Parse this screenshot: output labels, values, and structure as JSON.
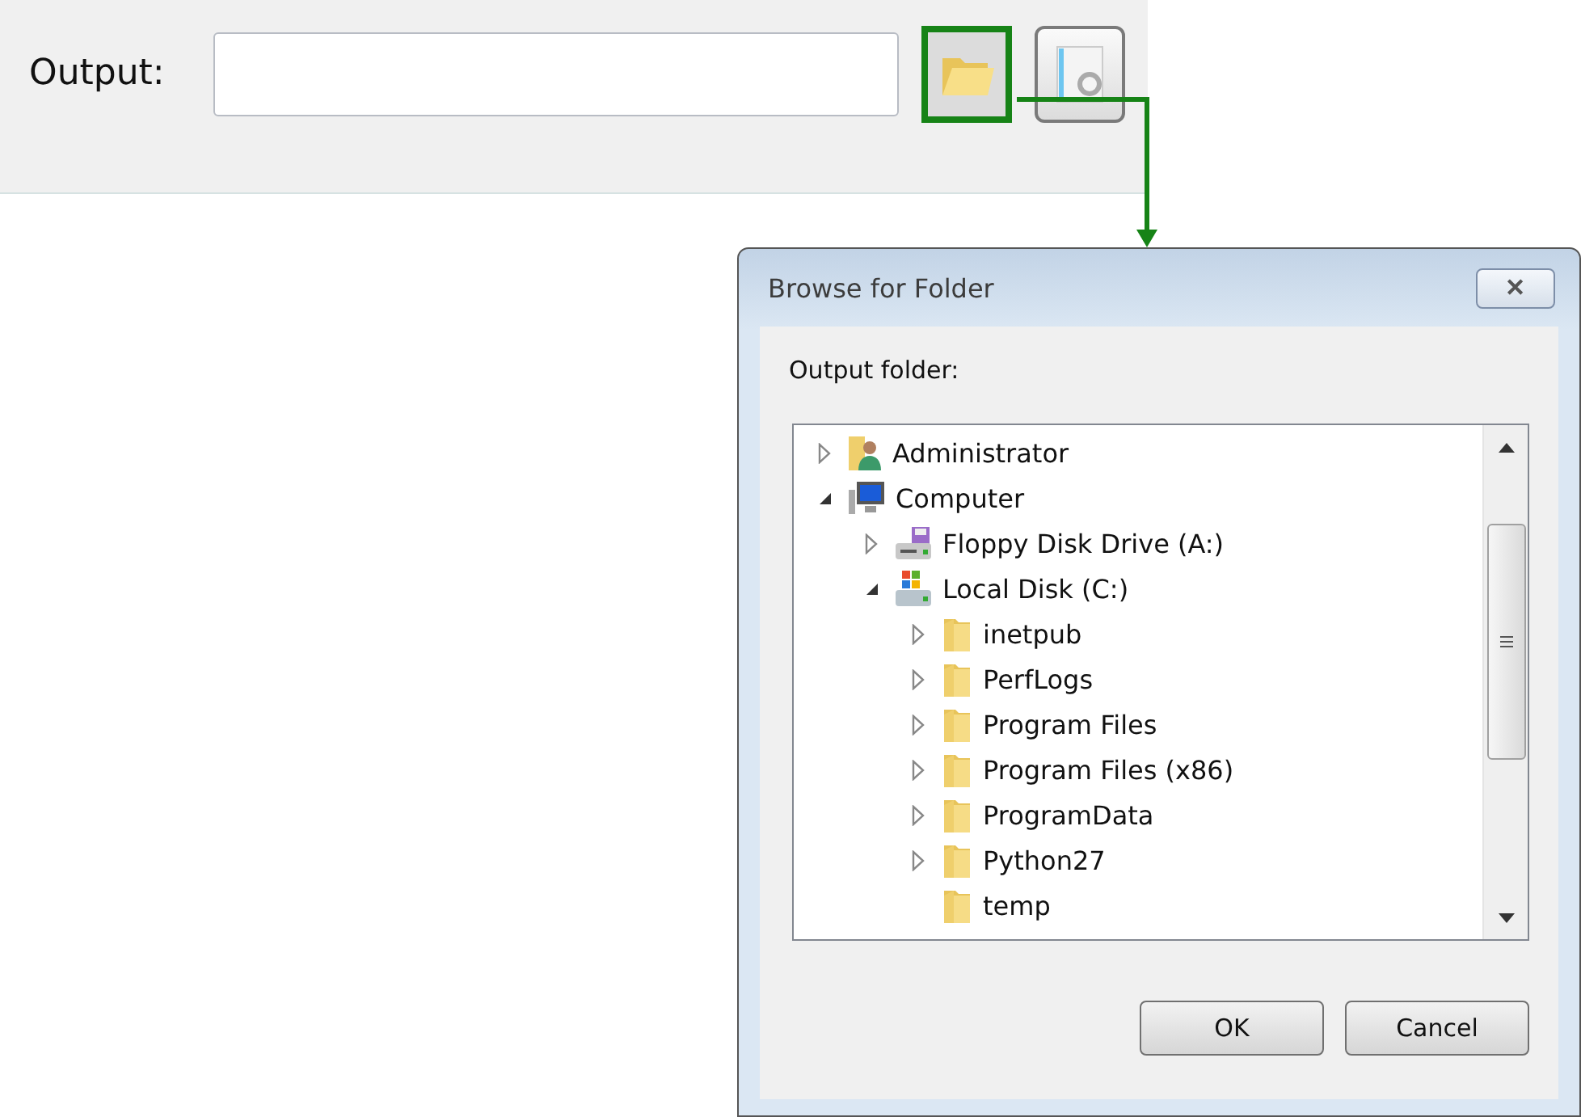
{
  "panel": {
    "output_label": "Output:"
  },
  "dialog": {
    "title": "Browse for Folder",
    "close": "✕",
    "prompt": "Output folder:",
    "tree": [
      {
        "label": "Administrator",
        "kind": "user-folder",
        "expanded": false,
        "leaf": false
      },
      {
        "label": "Computer",
        "kind": "computer",
        "expanded": true,
        "leaf": false,
        "children": [
          {
            "label": "Floppy Disk Drive (A:)",
            "kind": "floppy",
            "expanded": false,
            "leaf": false
          },
          {
            "label": "Local Disk (C:)",
            "kind": "disk",
            "expanded": true,
            "leaf": false,
            "children": [
              {
                "label": "inetpub",
                "kind": "folder",
                "expanded": false,
                "leaf": false
              },
              {
                "label": "PerfLogs",
                "kind": "folder",
                "expanded": false,
                "leaf": false
              },
              {
                "label": "Program Files",
                "kind": "folder",
                "expanded": false,
                "leaf": false
              },
              {
                "label": "Program Files (x86)",
                "kind": "folder",
                "expanded": false,
                "leaf": false
              },
              {
                "label": "ProgramData",
                "kind": "folder",
                "expanded": false,
                "leaf": false
              },
              {
                "label": "Python27",
                "kind": "folder",
                "expanded": false,
                "leaf": false
              },
              {
                "label": "temp",
                "kind": "folder",
                "expanded": false,
                "leaf": true
              }
            ]
          }
        ]
      }
    ],
    "buttons": [
      "OK",
      "Cancel"
    ]
  }
}
